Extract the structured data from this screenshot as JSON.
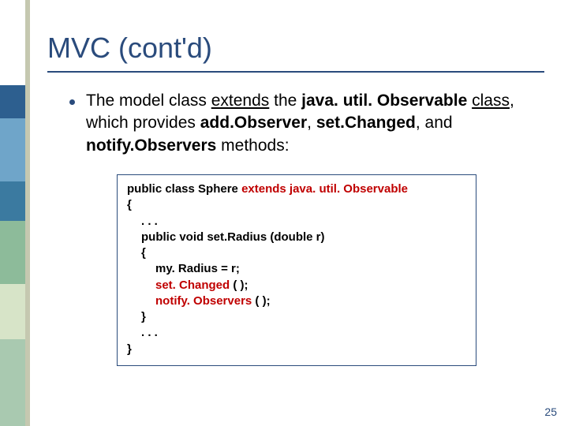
{
  "title": "MVC (cont'd)",
  "bullet": {
    "t1": "The model class ",
    "u1": "extends",
    "t2": " the ",
    "b1": "java. util. Observable",
    "t3": " ",
    "u2": "class",
    "t4": ", which provides ",
    "b2": "add.Observer",
    "t5": ", ",
    "b3": "set.Changed",
    "t6": ", and ",
    "b4": "notify.Observers",
    "t7": " methods:"
  },
  "code": {
    "l1a": "public class Sphere ",
    "l1b": "extends java. util. Observable",
    "l2": "{",
    "l3": ". . .",
    "l4": "public void set.Radius (double r)",
    "l5": "{",
    "l6": "my. Radius = r;",
    "l7a": "set. Changed",
    "l7b": " ( );",
    "l8a": "notify. Observers",
    "l8b": " ( );",
    "l9": "}",
    "l10": ". . .",
    "l11": "}"
  },
  "pagenum": "25"
}
